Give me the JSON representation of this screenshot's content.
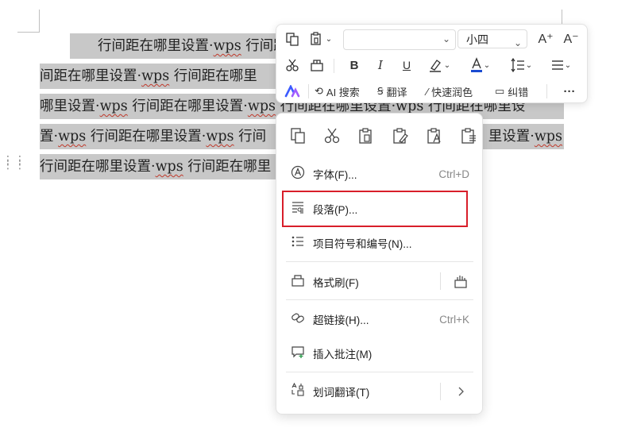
{
  "document": {
    "lines": [
      "　　行间距在哪里设置·wps 行间距",
      "间距在哪里设置·wps 行间距在哪里",
      "哪里设置·wps 行间距在哪里设置·wps 行间距在哪里设置·wps 行间距在哪里设",
      "置·wps 行间距在哪里设置·wps 行间",
      "行间距在哪里设置·wps 行间距在哪里"
    ],
    "line3_tail": "里设置·wps"
  },
  "toolbar": {
    "font_value": "",
    "size_value": "小四",
    "grow_label": "A⁺",
    "shrink_label": "A⁻",
    "bold": "B",
    "italic": "I",
    "underline": "U",
    "ai_search": "AI 搜索",
    "translate": "翻译",
    "quick_polish": "快速润色",
    "correct": "纠错",
    "more": "···"
  },
  "menu": {
    "items": [
      {
        "label": "字体(F)...",
        "shortcut": "Ctrl+D"
      },
      {
        "label": "段落(P)...",
        "shortcut": ""
      },
      {
        "label": "项目符号和编号(N)...",
        "shortcut": ""
      },
      {
        "label": "格式刷(F)",
        "shortcut": ""
      },
      {
        "label": "超链接(H)...",
        "shortcut": "Ctrl+K"
      },
      {
        "label": "插入批注(M)",
        "shortcut": ""
      },
      {
        "label": "划词翻译(T)",
        "shortcut": ""
      }
    ]
  },
  "colors": {
    "highlight_border": "#d81e2a",
    "selection": "#c8c8c8"
  }
}
